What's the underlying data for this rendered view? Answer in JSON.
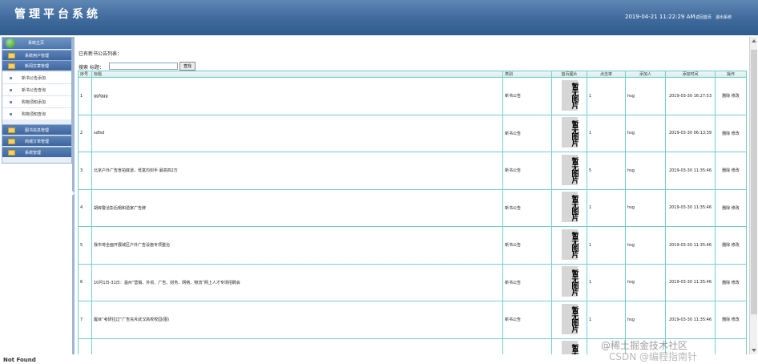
{
  "header": {
    "title": "管理平台系统",
    "datetime": "2019-04-21 11:22:29 AM",
    "links": [
      "返回首页",
      "退出系统"
    ]
  },
  "sidebar": {
    "top": "系统主页",
    "items": [
      {
        "label": "系统用户管理"
      },
      {
        "label": "新闻文章管理"
      },
      {
        "label": "新书公告添加"
      },
      {
        "label": "新书公告查询"
      },
      {
        "label": "购物须知添加"
      },
      {
        "label": "购物须知查询"
      },
      {
        "label": "图书信息管理"
      },
      {
        "label": "商城订单管理"
      },
      {
        "label": "系统管理"
      }
    ]
  },
  "main": {
    "heading": "已有新书公告列表：",
    "search": {
      "label1": "搜索",
      "label2": "标题：",
      "button": "查找",
      "value": ""
    },
    "columns": [
      "序号",
      "标题",
      "类别",
      "首页图片",
      "点击率",
      "添加人",
      "添加时间",
      "操作"
    ],
    "no_image": "暂无图片",
    "actions": [
      "删除",
      "修改"
    ],
    "rows": [
      {
        "no": "1",
        "title": "ggfggg",
        "type": "新书公告",
        "clicks": "1",
        "user": "hsg",
        "time": "2019-03-30 16:27:53"
      },
      {
        "no": "2",
        "title": "sdfsd",
        "type": "新书公告",
        "clicks": "1",
        "user": "hsg",
        "time": "2019-03-30 06:13:39"
      },
      {
        "no": "3",
        "title": "北京户外广告盲拍底道，低富均封手 最高四2万",
        "type": "新书公告",
        "clicks": "5",
        "user": "hsg",
        "time": "2019-03-30 11:35:46"
      },
      {
        "no": "4",
        "title": "胡库警洽彭后帽和遗家广告牌",
        "type": "新书公告",
        "clicks": "1",
        "user": "hsg",
        "time": "2019-03-30 11:35:46"
      },
      {
        "no": "5",
        "title": "我市将全面开展城区户外广告设施专项整治",
        "type": "新书公告",
        "clicks": "1",
        "user": "hsg",
        "time": "2019-03-30 11:35:46"
      },
      {
        "no": "6",
        "title": "10月1日-31日：温州“营销、外贸、广告、财务、网络、物流”网上人才专场招聘会",
        "type": "新书公告",
        "clicks": "1",
        "user": "hsg",
        "time": "2019-03-30 11:35:46"
      },
      {
        "no": "7",
        "title": "醒目“考研拉过”广告充斥武汉高校校园(图)",
        "type": "新书公告",
        "clicks": "1",
        "user": "hsg",
        "time": "2019-03-30 11:35:46"
      }
    ]
  },
  "footer": {
    "bottom_left": "Not Found",
    "watermark1": "@稀土掘金技术社区",
    "watermark2": "CSDN @编程指南针"
  }
}
